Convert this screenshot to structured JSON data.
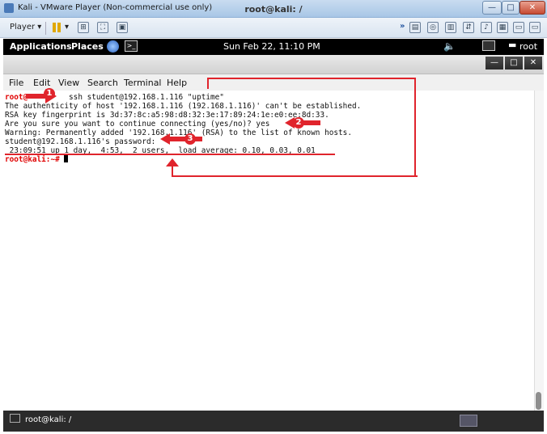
{
  "window": {
    "title": "Kali - VMware Player (Non-commercial use only)",
    "controls": [
      "—",
      "□",
      "✕"
    ]
  },
  "vmware_toolbar": {
    "player_label": "Player",
    "right_icons": [
      "»"
    ]
  },
  "kali_panel": {
    "applications": "Applications",
    "places": "Places",
    "clock": "Sun Feb 22, 11:10 PM",
    "user": "root"
  },
  "terminal": {
    "title": "root@kali: /",
    "menu": [
      "File",
      "Edit",
      "View",
      "Search",
      "Terminal",
      "Help"
    ],
    "lines": [
      {
        "prompt": "root@",
        "text": "         ssh student@192.168.1.116 \"uptime\""
      },
      {
        "prompt": "",
        "text": "The authenticity of host '192.168.1.116 (192.168.1.116)' can't be established."
      },
      {
        "prompt": "",
        "text": "RSA key fingerprint is 3d:37:8c:a5:98:d8:32:3e:17:89:24:1e:e0:ee:8d:33."
      },
      {
        "prompt": "",
        "text": "Are you sure you want to continue connecting (yes/no)? yes"
      },
      {
        "prompt": "",
        "text": "Warning: Permanently added '192.168.1.116' (RSA) to the list of known hosts."
      },
      {
        "prompt": "",
        "text": "student@192.168.1.116's password:"
      },
      {
        "prompt": "",
        "text": " 23:09:51 up 1 day,  4:53,  2 users,  load average: 0.10, 0.03, 0.01"
      },
      {
        "prompt": "root@kali:~# ",
        "text": ""
      }
    ]
  },
  "annotations": {
    "badge1": "1",
    "badge2": "2",
    "badge3": "3"
  },
  "taskbar": {
    "item": "root@kali: /"
  }
}
